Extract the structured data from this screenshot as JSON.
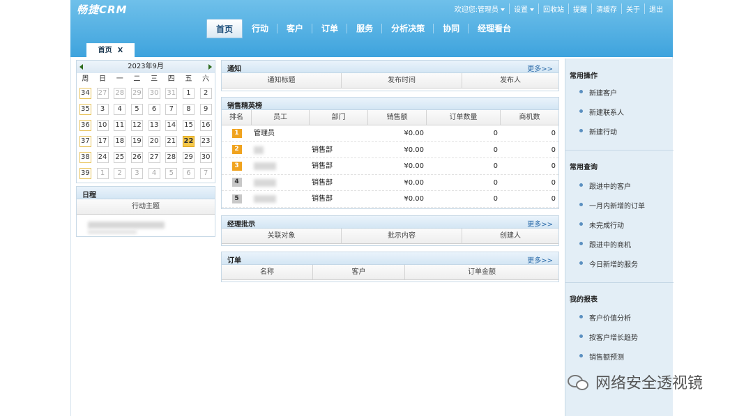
{
  "app": {
    "logo": "畅捷CRM"
  },
  "toplinks": {
    "welcome": "欢迎您:",
    "user": "管理员",
    "settings": "设置",
    "recycle": "回收站",
    "remind": "提醒",
    "clear_cache": "清缓存",
    "about": "关于",
    "logout": "退出"
  },
  "nav": [
    "首页",
    "行动",
    "客户",
    "订单",
    "服务",
    "分析决策",
    "协同",
    "经理看台"
  ],
  "page_tab": {
    "label": "首页",
    "close": "X"
  },
  "calendar": {
    "title": "2023年9月",
    "weekdays": [
      "周",
      "日",
      "一",
      "二",
      "三",
      "四",
      "五",
      "六"
    ],
    "rows": [
      [
        "34",
        "27",
        "28",
        "29",
        "30",
        "31",
        "1",
        "2"
      ],
      [
        "35",
        "3",
        "4",
        "5",
        "6",
        "7",
        "8",
        "9"
      ],
      [
        "36",
        "10",
        "11",
        "12",
        "13",
        "14",
        "15",
        "16"
      ],
      [
        "37",
        "17",
        "18",
        "19",
        "20",
        "21",
        "22",
        "23"
      ],
      [
        "38",
        "24",
        "25",
        "26",
        "27",
        "28",
        "29",
        "30"
      ],
      [
        "39",
        "1",
        "2",
        "3",
        "4",
        "5",
        "6",
        "7"
      ]
    ],
    "today": "22"
  },
  "schedule": {
    "title": "日程",
    "column": "行动主题"
  },
  "notice": {
    "title": "通知",
    "more": "更多>>",
    "columns": [
      "通知标题",
      "发布时间",
      "发布人"
    ]
  },
  "sales_rank": {
    "title": "销售精英榜",
    "columns": [
      "排名",
      "员工",
      "部门",
      "销售额",
      "订单数量",
      "商机数"
    ],
    "rows": [
      {
        "rank": "1",
        "employee": "管理员",
        "dept": "",
        "sales": "¥0.00",
        "orders": "0",
        "opps": "0"
      },
      {
        "rank": "2",
        "employee": "",
        "dept": "销售部",
        "sales": "¥0.00",
        "orders": "0",
        "opps": "0"
      },
      {
        "rank": "3",
        "employee": "",
        "dept": "销售部",
        "sales": "¥0.00",
        "orders": "0",
        "opps": "0"
      },
      {
        "rank": "4",
        "employee": "",
        "dept": "销售部",
        "sales": "¥0.00",
        "orders": "0",
        "opps": "0"
      },
      {
        "rank": "5",
        "employee": "",
        "dept": "销售部",
        "sales": "¥0.00",
        "orders": "0",
        "opps": "0"
      }
    ]
  },
  "approval": {
    "title": "经理批示",
    "more": "更多>>",
    "columns": [
      "关联对象",
      "批示内容",
      "创建人"
    ]
  },
  "orders": {
    "title": "订单",
    "more": "更多>>",
    "columns": [
      "名称",
      "客户",
      "订单金额"
    ]
  },
  "quick_ops": {
    "title": "常用操作",
    "items": [
      "新建客户",
      "新建联系人",
      "新建行动"
    ]
  },
  "queries": {
    "title": "常用查询",
    "items": [
      "跟进中的客户",
      "一月内新增的订单",
      "未完成行动",
      "跟进中的商机",
      "今日新增的服务"
    ]
  },
  "reports": {
    "title": "我的报表",
    "items": [
      "客户价值分析",
      "按客户增长趋势",
      "销售额预测"
    ]
  },
  "watermark": "网络安全透视镜"
}
